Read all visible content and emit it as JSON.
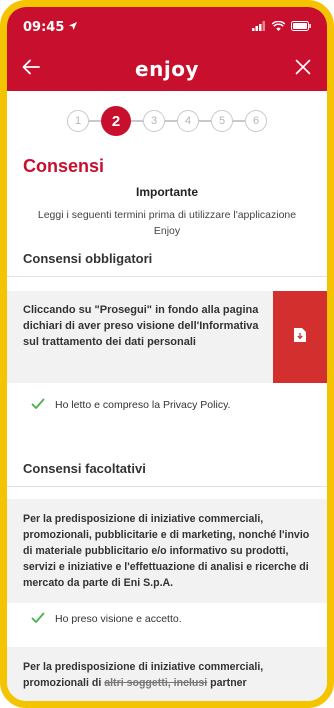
{
  "status_bar": {
    "time": "09:45"
  },
  "header": {
    "logo": "enjoy",
    "back_icon": "arrow-left-icon",
    "close_icon": "close-icon"
  },
  "stepper": {
    "steps": [
      "1",
      "2",
      "3",
      "4",
      "5",
      "6"
    ],
    "active": "2"
  },
  "page": {
    "title": "Consensi",
    "subtitle": "Importante",
    "intro": "Leggi i seguenti termini prima di utilizzare l'applicazione Enjoy"
  },
  "mandatory": {
    "title": "Consensi obbligatori",
    "info_text": "Cliccando su \"Prosegui\" in fondo alla pagina dichiari di aver preso visione dell'Informativa sul trattamento dei dati personali",
    "checkbox_label": "Ho letto e compreso la Privacy Policy."
  },
  "optional": {
    "title": "Consensi facoltativi",
    "text1": "Per la predisposizione di iniziative commerciali, promozionali, pubblicitarie e di marketing, nonché l'invio di materiale pubblicitario e/o informativo su prodotti, servizi e iniziative e l'effettuazione di analisi e ricerche di mercato da parte di Eni S.p.A.",
    "checkbox_label": "Ho preso visione e accetto.",
    "text2_line1": "Per la predisposizione di iniziative commerciali,",
    "text2_line2_start": "promozionali di ",
    "text2_strike": "altri soggetti, inclusi",
    "text2_line2_end": " partner"
  },
  "colors": {
    "brand_red": "#c8102e",
    "frame_yellow": "#f5c400",
    "check_green": "#4caf50"
  }
}
